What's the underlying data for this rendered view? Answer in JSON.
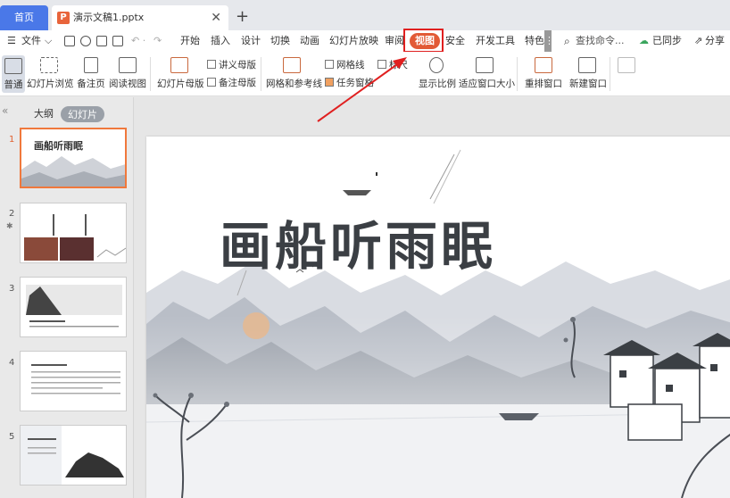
{
  "tabs": {
    "home": "首页",
    "doc_title": "演示文稿1.pptx",
    "close": "✕",
    "add": "+"
  },
  "menubar": {
    "file": "文件",
    "items": [
      "开始",
      "插入",
      "设计",
      "切换",
      "动画",
      "幻灯片放映",
      "审阅",
      "视图",
      "安全",
      "开发工具",
      "特色"
    ],
    "search": "查找命令...",
    "sync": "已同步",
    "share": "分享"
  },
  "ribbon": {
    "normal": "普通",
    "slide_sorter": "幻灯片浏览",
    "notes_page": "备注页",
    "reading_view": "阅读视图",
    "slide_master": "幻灯片母版",
    "handout_master": "讲义母版",
    "notes_master": "备注母版",
    "grid_guides": "网格和参考线",
    "gridlines": "网格线",
    "ruler": "标尺",
    "task_pane": "任务窗格",
    "zoom": "显示比例",
    "fit_window": "适应窗口大小",
    "arrange": "重排窗口",
    "new_window": "新建窗口"
  },
  "left_panel": {
    "tab_outline": "大纲",
    "tab_slides": "幻灯片",
    "slides": [
      "1",
      "2",
      "3",
      "4",
      "5"
    ]
  },
  "slide": {
    "title": "画船听雨眠"
  },
  "colors": {
    "accent": "#e25a36",
    "home_tab": "#4a78e8",
    "highlight": "#e02020"
  }
}
